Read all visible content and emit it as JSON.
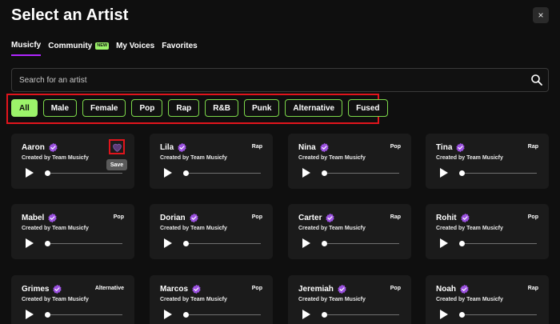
{
  "modal": {
    "title": "Select an Artist",
    "close_label": "×"
  },
  "tabs": [
    {
      "label": "Musicfy",
      "active": true
    },
    {
      "label": "Community",
      "badge": "NEW"
    },
    {
      "label": "My Voices"
    },
    {
      "label": "Favorites"
    }
  ],
  "search": {
    "placeholder": "Search for an artist",
    "value": ""
  },
  "filters": [
    "All",
    "Male",
    "Female",
    "Pop",
    "Rap",
    "R&B",
    "Punk",
    "Alternative",
    "Fused"
  ],
  "tooltip": "Save",
  "colors": {
    "accent_purple": "#b026ff",
    "accent_green": "#9cf36a",
    "highlight_red": "#e1141c",
    "verified_purple": "#9b51e0"
  },
  "artists": [
    {
      "name": "Aaron",
      "genre": "",
      "creator": "Created by Team Musicfy"
    },
    {
      "name": "Lila",
      "genre": "Rap",
      "creator": "Created by Team Musicfy"
    },
    {
      "name": "Nina",
      "genre": "Pop",
      "creator": "Created by Team Musicfy"
    },
    {
      "name": "Tina",
      "genre": "Rap",
      "creator": "Created by Team Musicfy"
    },
    {
      "name": "Mabel",
      "genre": "Pop",
      "creator": "Created by Team Musicfy"
    },
    {
      "name": "Dorian",
      "genre": "Pop",
      "creator": "Created by Team Musicfy"
    },
    {
      "name": "Carter",
      "genre": "Rap",
      "creator": "Created by Team Musicfy"
    },
    {
      "name": "Rohit",
      "genre": "Pop",
      "creator": "Created by Team Musicfy"
    },
    {
      "name": "Grimes",
      "genre": "Alternative",
      "creator": "Created by Team Musicfy"
    },
    {
      "name": "Marcos",
      "genre": "Pop",
      "creator": "Created by Team Musicfy"
    },
    {
      "name": "Jeremiah",
      "genre": "Pop",
      "creator": "Created by Team Musicfy"
    },
    {
      "name": "Noah",
      "genre": "Rap",
      "creator": "Created by Team Musicfy"
    }
  ]
}
